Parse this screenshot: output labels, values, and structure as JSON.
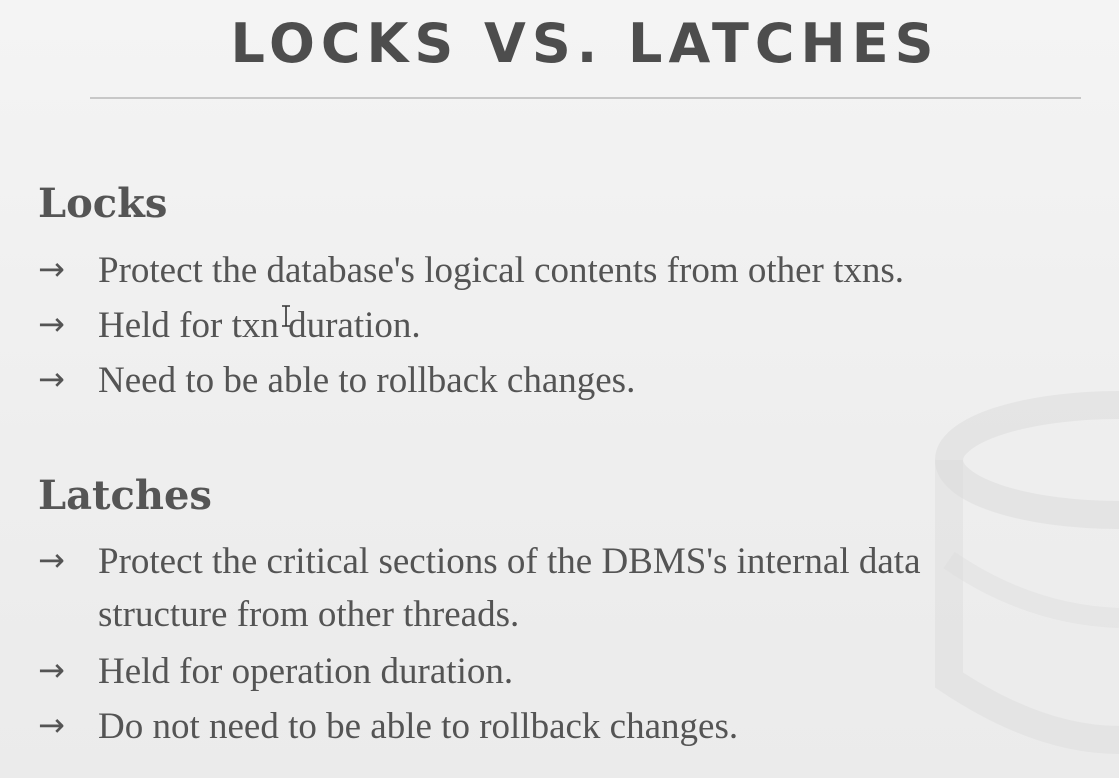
{
  "slide": {
    "title": "LOCKS VS. LATCHES",
    "arrow": "→",
    "locks": {
      "heading": "Locks",
      "bullets": [
        "Protect the database's logical contents from other txns.",
        "Held for txn duration.",
        "Need to be able to rollback changes."
      ]
    },
    "latches": {
      "heading": "Latches",
      "bullets": [
        "Protect the critical sections of the DBMS's internal data",
        "Held for operation duration.",
        "Do not need to be able to rollback changes."
      ],
      "bullet_1_continuation": "structure from other threads."
    }
  }
}
